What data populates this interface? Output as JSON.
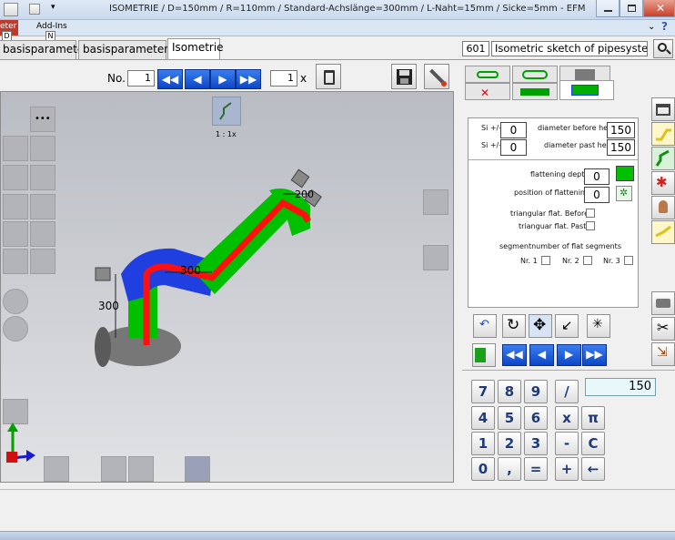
{
  "window": {
    "title": "ISOMETRIE / D=150mm  / R=110mm   / Standard-Achslänge=300mm  / L-Naht=15mm  / Sicke=5mm  - EFM",
    "ribbon_tab_1": "eter",
    "ribbon_tab_1_key": "D",
    "ribbon_tab_2": "Add-Ins",
    "ribbon_tab_2_key": "N"
  },
  "tabs": [
    "basisparameters",
    "basisparameters",
    "Isometrie"
  ],
  "search": {
    "code": "601",
    "title": "Isometric sketch of pipesystem"
  },
  "toolbar": {
    "no_label": "No.",
    "no_value": "1",
    "count_value": "1",
    "count_suffix": "x"
  },
  "viewport": {
    "scale_label": "1 : 1x",
    "dimensions": [
      "300",
      "300",
      "200"
    ]
  },
  "params": {
    "si_label_1": "Si +/-",
    "si_value_1": "0",
    "diameter_before_label": "diameter before here",
    "diameter_before_value": "150",
    "si_label_2": "Si +/-",
    "si_value_2": "0",
    "diameter_past_label": "diameter past here",
    "diameter_past_value": "150",
    "flattening_depth_label": "flattening depth",
    "flattening_depth_value": "0",
    "flattening_position_label": "position of flattening",
    "flattening_position_value": "0",
    "tri_before_label": "triangular flat. Before",
    "tri_past_label": "trianguar flat. Past",
    "segment_label": "segmentnumber of flat segments",
    "nr1": "Nr. 1",
    "nr2": "Nr. 2",
    "nr3": "Nr. 3"
  },
  "calculator": {
    "display": "150",
    "keys": [
      "7",
      "8",
      "9",
      "/",
      "4",
      "5",
      "6",
      "x",
      "π",
      "1",
      "2",
      "3",
      "-",
      "C",
      "0",
      ",",
      "=",
      "+",
      "←"
    ]
  },
  "colors": {
    "pipe_green": "#00c000",
    "pipe_blue": "#1f3fe0",
    "pipe_red": "#ff1010",
    "nav_blue": "#1a5fe0"
  }
}
